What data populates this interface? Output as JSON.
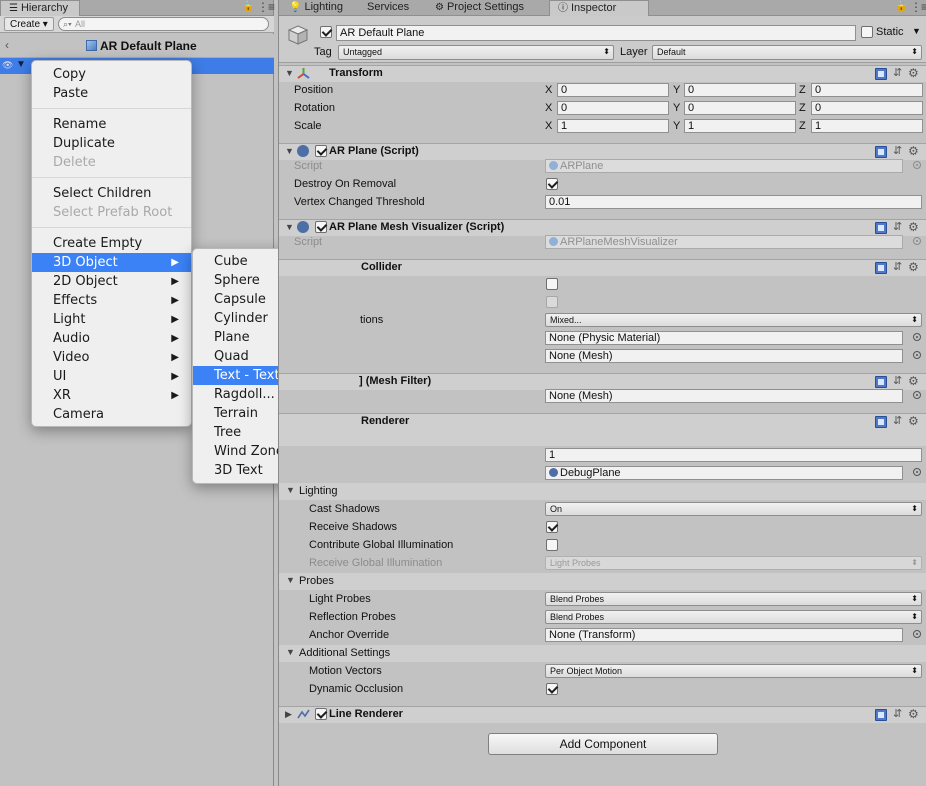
{
  "hierarchy": {
    "tab_label": "Hierarchy",
    "create_label": "Create ▾",
    "search_placeholder": "All",
    "scene_title": "AR Default Plane"
  },
  "context_menu": {
    "items": [
      {
        "label": "Copy",
        "disabled": false
      },
      {
        "label": "Paste",
        "disabled": false
      },
      {
        "label": "Rename",
        "disabled": false
      },
      {
        "label": "Duplicate",
        "disabled": false
      },
      {
        "label": "Delete",
        "disabled": true
      },
      {
        "label": "Select Children",
        "disabled": false
      },
      {
        "label": "Select Prefab Root",
        "disabled": true
      },
      {
        "label": "Create Empty",
        "disabled": false
      },
      {
        "label": "3D Object",
        "has_submenu": true,
        "selected": true
      },
      {
        "label": "2D Object",
        "has_submenu": true
      },
      {
        "label": "Effects",
        "has_submenu": true
      },
      {
        "label": "Light",
        "has_submenu": true
      },
      {
        "label": "Audio",
        "has_submenu": true
      },
      {
        "label": "Video",
        "has_submenu": true
      },
      {
        "label": "UI",
        "has_submenu": true
      },
      {
        "label": "XR",
        "has_submenu": true
      },
      {
        "label": "Camera"
      }
    ],
    "submenu": [
      "Cube",
      "Sphere",
      "Capsule",
      "Cylinder",
      "Plane",
      "Quad",
      "Text - TextMeshPro",
      "Ragdoll...",
      "Terrain",
      "Tree",
      "Wind Zone",
      "3D Text"
    ],
    "submenu_selected": "Text - TextMeshPro",
    "highlight_color": "#3b82f6"
  },
  "inspector_tabs": {
    "lighting": "Lighting",
    "services": "Services",
    "project_settings": "Project Settings",
    "inspector": "Inspector"
  },
  "gameobject": {
    "name": "AR Default Plane",
    "active": true,
    "static_label": "Static",
    "tag_label": "Tag",
    "tag_value": "Untagged",
    "layer_label": "Layer",
    "layer_value": "Default"
  },
  "transform": {
    "title": "Transform",
    "position_label": "Position",
    "rotation_label": "Rotation",
    "scale_label": "Scale",
    "axis_x": "X",
    "axis_y": "Y",
    "axis_z": "Z",
    "position": [
      "0",
      "0",
      "0"
    ],
    "rotation": [
      "0",
      "0",
      "0"
    ],
    "scale": [
      "1",
      "1",
      "1"
    ]
  },
  "ar_plane": {
    "title": "AR Plane (Script)",
    "script_label": "Script",
    "script_value": "ARPlane",
    "destroy_label": "Destroy On Removal",
    "destroy_on_removal": true,
    "threshold_label": "Vertex Changed Threshold",
    "threshold_value": "0.01"
  },
  "ar_mesh_vis": {
    "title": "AR Plane Mesh Visualizer (Script)",
    "script_label": "Script",
    "script_value": "ARPlaneMeshVisualizer"
  },
  "mesh_collider": {
    "title_fragment": "Collider",
    "options_fragment": "tions",
    "cooking_value": "Mixed...",
    "material_value": "None (Physic Material)",
    "mesh_value": "None (Mesh)"
  },
  "mesh_filter": {
    "title_fragment": "] (Mesh Filter)",
    "mesh_value": "None (Mesh)"
  },
  "mesh_renderer": {
    "title_fragment": "Renderer",
    "materials_size": "1",
    "element_value": "DebugPlane",
    "lighting_label": "Lighting",
    "cast_shadows_label": "Cast Shadows",
    "cast_shadows_value": "On",
    "receive_shadows_label": "Receive Shadows",
    "receive_shadows": true,
    "contribute_gi_label": "Contribute Global Illumination",
    "contribute_gi": false,
    "receive_gi_label": "Receive Global Illumination",
    "receive_gi_value": "Light Probes",
    "probes_label": "Probes",
    "light_probes_label": "Light Probes",
    "light_probes_value": "Blend Probes",
    "reflection_probes_label": "Reflection Probes",
    "reflection_probes_value": "Blend Probes",
    "anchor_override_label": "Anchor Override",
    "anchor_override_value": "None (Transform)",
    "additional_label": "Additional Settings",
    "motion_vectors_label": "Motion Vectors",
    "motion_vectors_value": "Per Object Motion",
    "dynamic_occlusion_label": "Dynamic Occlusion",
    "dynamic_occlusion": true
  },
  "line_renderer": {
    "title": "Line Renderer",
    "enabled": true
  },
  "add_component_label": "Add Component"
}
